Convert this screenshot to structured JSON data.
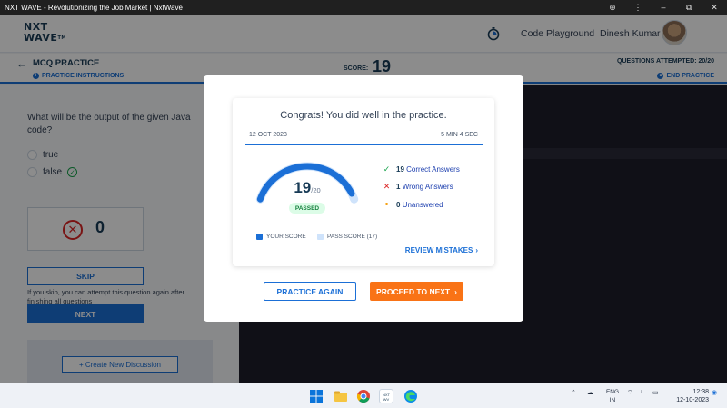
{
  "window": {
    "title": "NXT WAVE - Revolutionizing the Job Market | NxtWave",
    "controls": [
      "⊕",
      "⋮",
      "–",
      "⧉",
      "✕"
    ]
  },
  "header": {
    "logo_line1": "NXT",
    "logo_line2": "WAVE",
    "logo_tm": "TM",
    "code_playground": "Code Playground",
    "user_name": "Dinesh Kumar"
  },
  "practice_bar": {
    "title": "MCQ PRACTICE",
    "instructions": "PRACTICE INSTRUCTIONS",
    "score_label": "SCORE:",
    "score_value": "19",
    "questions_attempted": "QUESTIONS ATTEMPTED: 20/20",
    "end_practice": "END PRACTICE"
  },
  "question": {
    "text": "What will be the output of the given Java code?",
    "options": [
      {
        "label": "true"
      },
      {
        "label": "false"
      }
    ],
    "wrong_count": "0",
    "skip_label": "SKIP",
    "skip_note": "If you skip, you can attempt this question again after finishing all questions",
    "next_label": "NEXT",
    "create_discussion": "+ Create New Discussion"
  },
  "modal": {
    "heading": "Congrats! You did well in the practice.",
    "date": "12 OCT 2023",
    "duration": "5 MIN 4 SEC",
    "score": "19",
    "total": "/20",
    "score_fraction": 0.95,
    "pass_fraction": 0.85,
    "status": "PASSED",
    "legend_your_score": "YOUR SCORE",
    "legend_pass_score": "PASS SCORE (17)",
    "stats": {
      "correct_count": "19",
      "correct_label": "Correct Answers",
      "wrong_count": "1",
      "wrong_label": "Wrong Answers",
      "unanswered_count": "0",
      "unanswered_label": "Unanswered"
    },
    "review_mistakes": "REVIEW MISTAKES",
    "practice_again": "PRACTICE AGAIN",
    "proceed_next": "PROCEED TO NEXT"
  },
  "taskbar": {
    "lang_line1": "ENG",
    "lang_line2": "IN",
    "time": "12:38",
    "date": "12-10-2023"
  },
  "colors": {
    "primary": "#1b6fd6",
    "orange": "#f97316",
    "success": "#16a34a",
    "danger": "#dc2626",
    "warning": "#f59e0b",
    "pass_track": "#cfe3fb"
  }
}
